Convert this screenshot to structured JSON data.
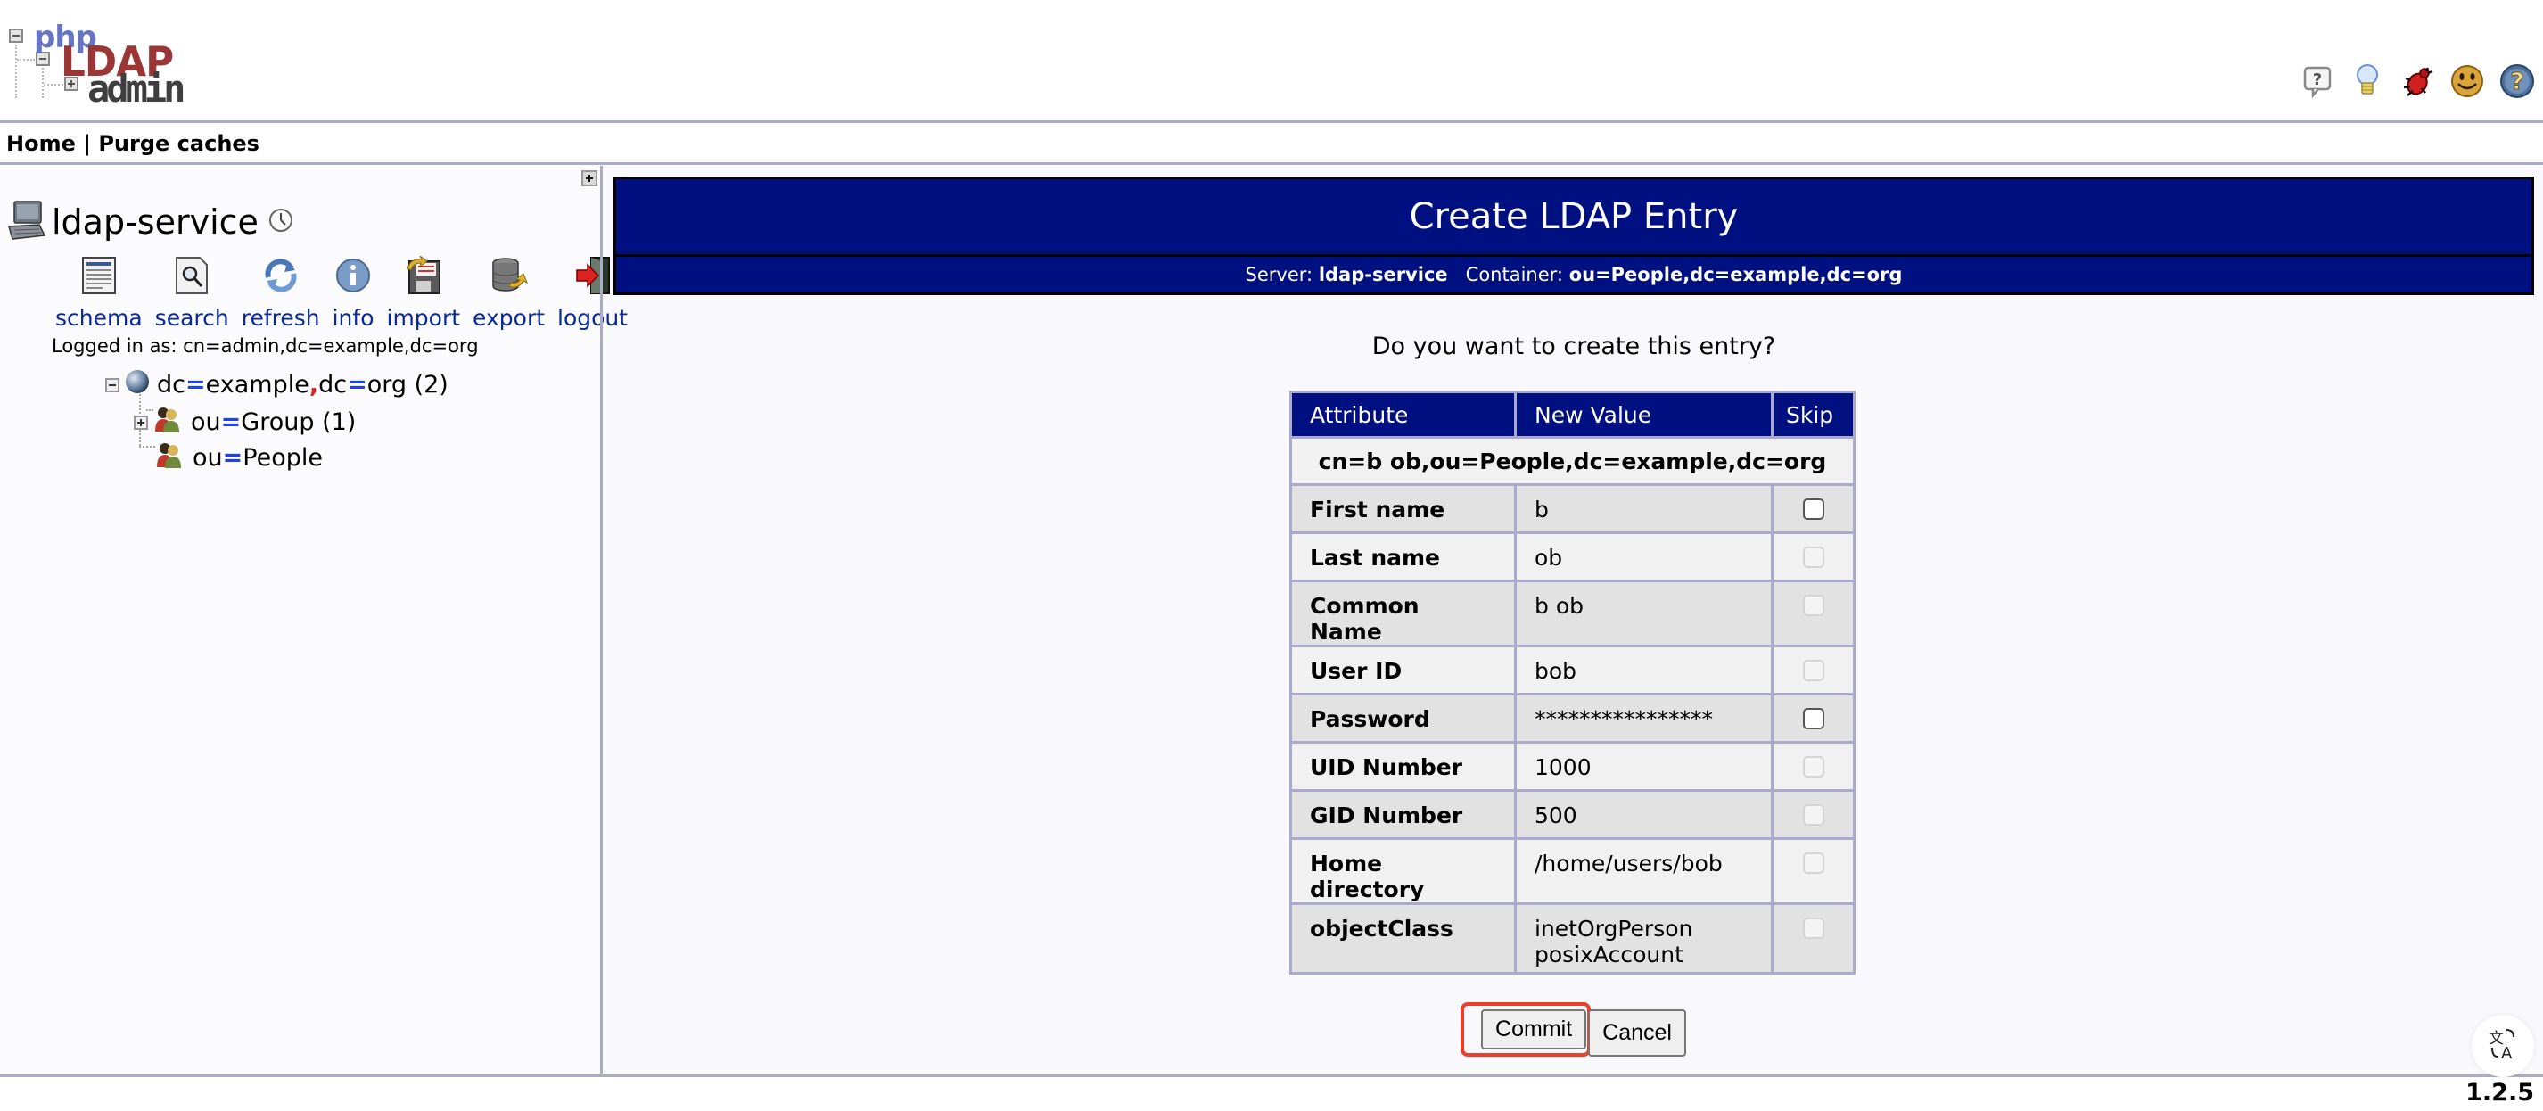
{
  "app": {
    "logo": {
      "php": "php",
      "ldap": "LDAP",
      "admin": "admin"
    },
    "header_icons": [
      {
        "name": "help-bubble-icon",
        "glyph": "?"
      },
      {
        "name": "lightbulb-icon",
        "glyph": ""
      },
      {
        "name": "bug-icon",
        "glyph": ""
      },
      {
        "name": "smiley-icon",
        "glyph": ""
      },
      {
        "name": "help-icon",
        "glyph": "?"
      }
    ],
    "version": "1.2.5"
  },
  "nav": {
    "home": "Home",
    "separator": "|",
    "purge": "Purge caches"
  },
  "sidebar": {
    "server_name": "ldap-service",
    "tools": [
      {
        "id": "schema",
        "label": "schema"
      },
      {
        "id": "search",
        "label": "search"
      },
      {
        "id": "refresh",
        "label": "refresh"
      },
      {
        "id": "info",
        "label": "info"
      },
      {
        "id": "import",
        "label": "import"
      },
      {
        "id": "export",
        "label": "export"
      },
      {
        "id": "logout",
        "label": "logout"
      }
    ],
    "logged_in": "Logged in as: cn=admin,dc=example,dc=org",
    "tree": {
      "root": {
        "a1": "dc",
        "v1": "example",
        "a2": "dc",
        "v2": "org",
        "count": "(2)"
      },
      "children": [
        {
          "attr": "ou",
          "value": "Group",
          "count": "(1)",
          "expandable": true
        },
        {
          "attr": "ou",
          "value": "People",
          "count": "",
          "expandable": false
        }
      ]
    }
  },
  "content": {
    "title": "Create LDAP Entry",
    "server_label": "Server:",
    "server_value": "ldap-service",
    "container_label": "Container:",
    "container_value": "ou=People,dc=example,dc=org",
    "question": "Do you want to create this entry?",
    "table": {
      "headers": {
        "attribute": "Attribute",
        "new_value": "New Value",
        "skip": "Skip"
      },
      "dn": "cn=b ob,ou=People,dc=example,dc=org",
      "rows": [
        {
          "name": "First name",
          "value": "b",
          "skip_enabled": true
        },
        {
          "name": "Last name",
          "value": "ob",
          "skip_enabled": false
        },
        {
          "name": "Common Name",
          "value": "b ob",
          "skip_enabled": false
        },
        {
          "name": "User ID",
          "value": "bob",
          "skip_enabled": false
        },
        {
          "name": "Password",
          "value": "****************",
          "skip_enabled": true
        },
        {
          "name": "UID Number",
          "value": "1000",
          "skip_enabled": false
        },
        {
          "name": "GID Number",
          "value": "500",
          "skip_enabled": false
        },
        {
          "name": "Home directory",
          "value": "/home/users/bob",
          "skip_enabled": false
        },
        {
          "name": "objectClass",
          "value": "inetOrgPerson",
          "value2": "posixAccount",
          "skip_enabled": false
        }
      ]
    },
    "buttons": {
      "commit": "Commit",
      "cancel": "Cancel"
    },
    "highlight_color": "#e8402a"
  },
  "colors": {
    "header_bg": "#001080",
    "divider": "#aaaacc",
    "link": "#0a2a9a"
  }
}
